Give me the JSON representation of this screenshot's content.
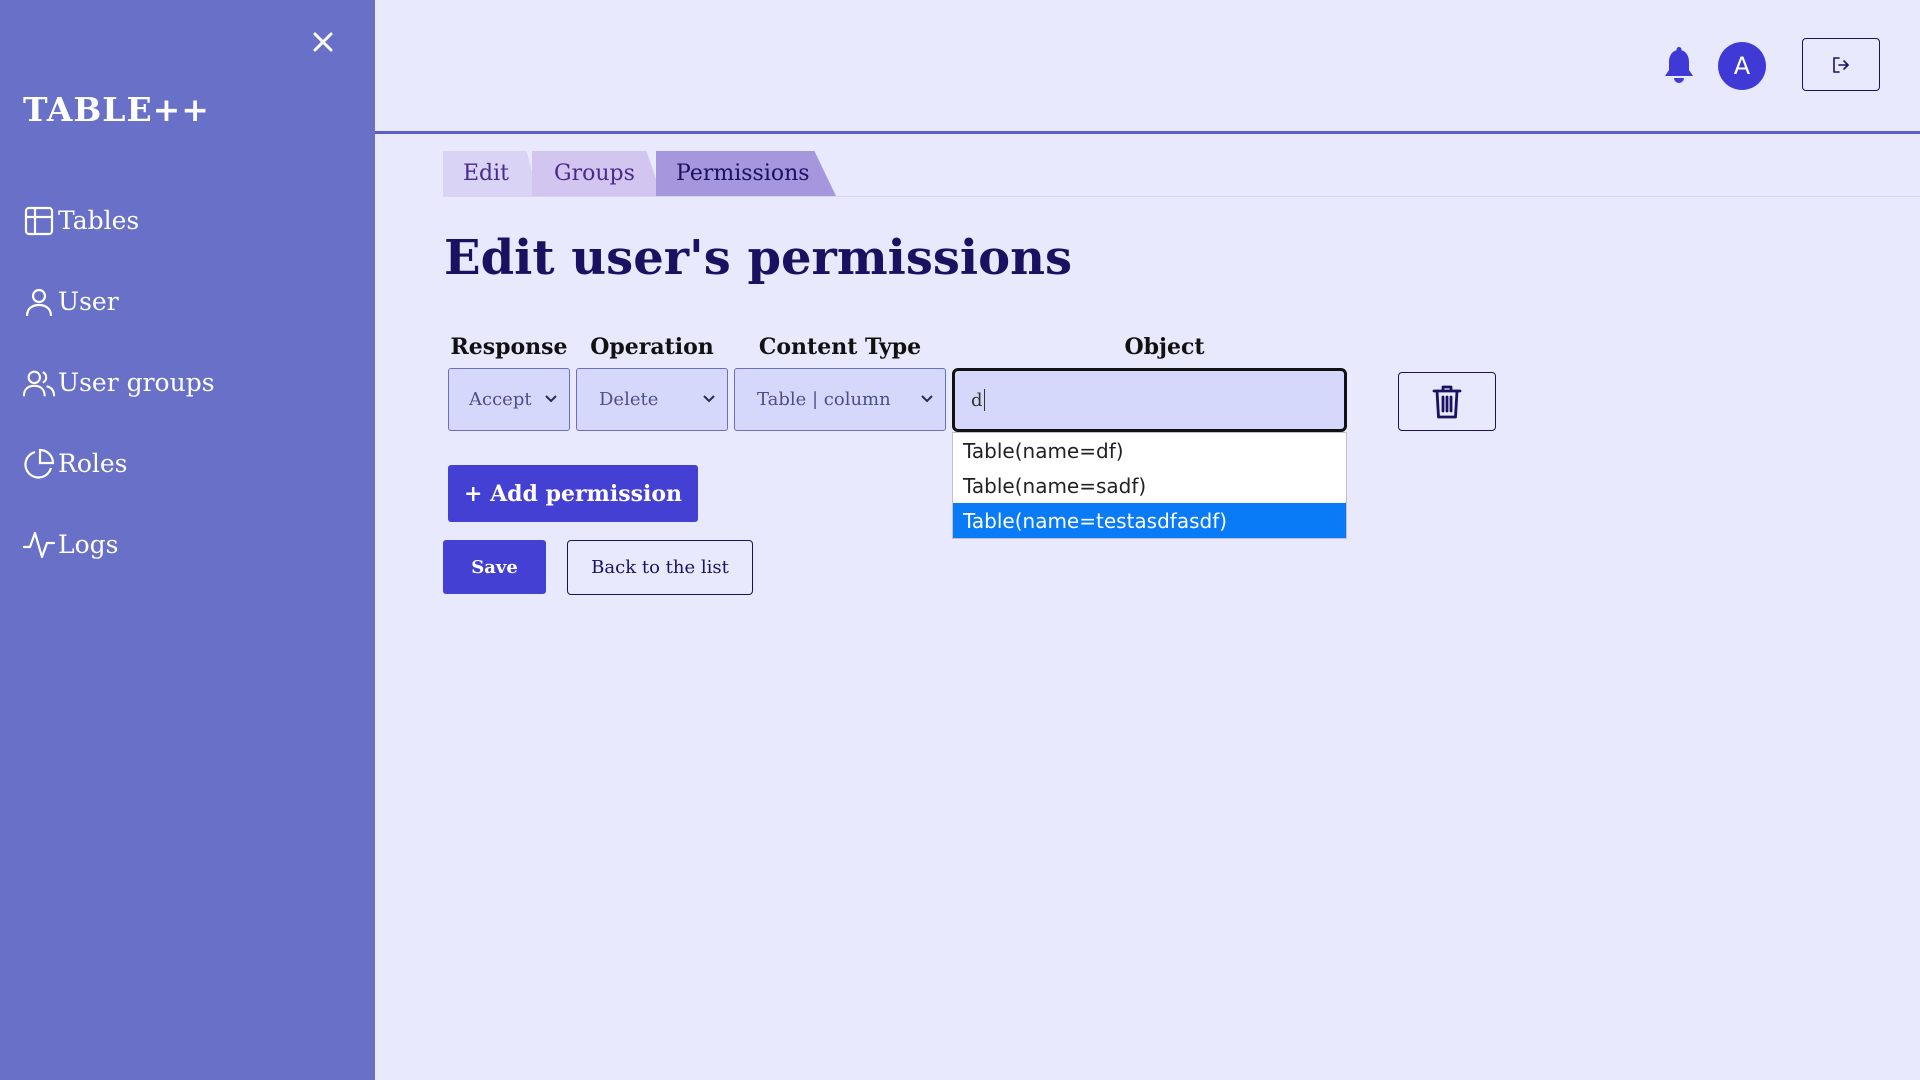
{
  "app": {
    "logo": "TABLE++"
  },
  "sidebar": {
    "items": [
      {
        "label": "Tables",
        "icon": "table-icon"
      },
      {
        "label": "User",
        "icon": "user-icon"
      },
      {
        "label": "User groups",
        "icon": "users-icon"
      },
      {
        "label": "Roles",
        "icon": "pie-chart-icon"
      },
      {
        "label": "Logs",
        "icon": "activity-icon"
      }
    ]
  },
  "header": {
    "avatar_initial": "A"
  },
  "tabs": [
    {
      "label": "Edit"
    },
    {
      "label": "Groups"
    },
    {
      "label": "Permissions",
      "active": true
    }
  ],
  "page": {
    "title": "Edit user's permissions"
  },
  "permission": {
    "columns": {
      "response": "Response",
      "operation": "Operation",
      "content_type": "Content Type",
      "object": "Object"
    },
    "response_value": "Accept",
    "operation_value": "Delete",
    "content_type_value": "Table | column",
    "object_value": "d",
    "suggestions": [
      {
        "label": "Table(name=df)"
      },
      {
        "label": "Table(name=sadf)"
      },
      {
        "label": "Table(name=testasdfasdf)",
        "selected": true
      }
    ]
  },
  "actions": {
    "add_permission": "+ Add permission",
    "save": "Save",
    "back": "Back to the list"
  },
  "colors": {
    "sidebar": "#6870c8",
    "primary": "#4440d4",
    "background": "#e8e9fc",
    "highlight": "#0a7bf7"
  }
}
